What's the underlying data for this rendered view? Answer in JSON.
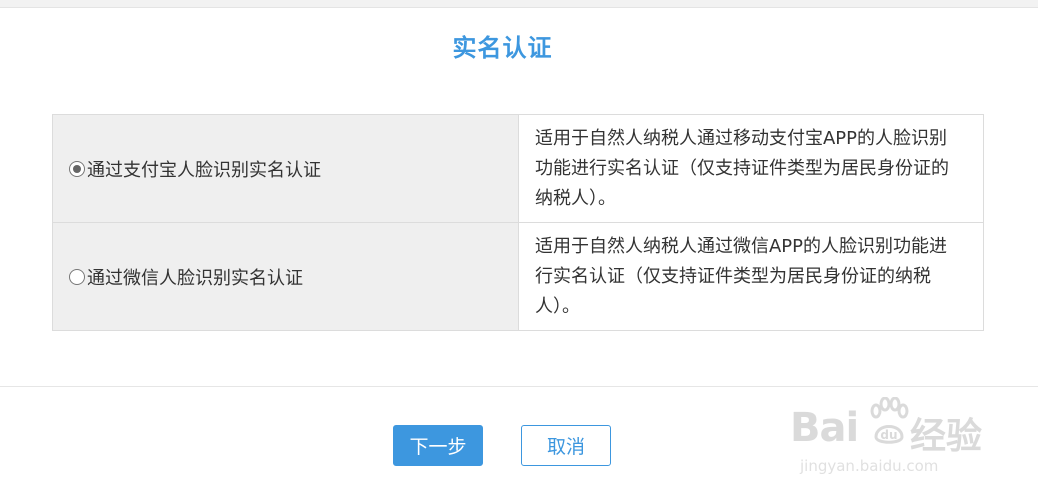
{
  "dialog": {
    "title": "实名认证"
  },
  "options": [
    {
      "label": "通过支付宝人脸识别实名认证",
      "selected": true,
      "description": "适用于自然人纳税人通过移动支付宝APP的人脸识别功能进行实名认证（仅支持证件类型为居民身份证的纳税人）。"
    },
    {
      "label": "通过微信人脸识别实名认证",
      "selected": false,
      "description": "适用于自然人纳税人通过微信APP的人脸识别功能进行实名认证（仅支持证件类型为居民身份证的纳税人）。"
    }
  ],
  "buttons": {
    "next_label": "下一步",
    "cancel_label": "取消"
  },
  "watermark": {
    "brand_latin": "Bai",
    "brand_du": "du",
    "brand_cn": "经验",
    "url": "jingyan.baidu.com"
  },
  "colors": {
    "accent": "#3d97df",
    "option_bg": "#efefef",
    "border": "#dcdcdc"
  }
}
